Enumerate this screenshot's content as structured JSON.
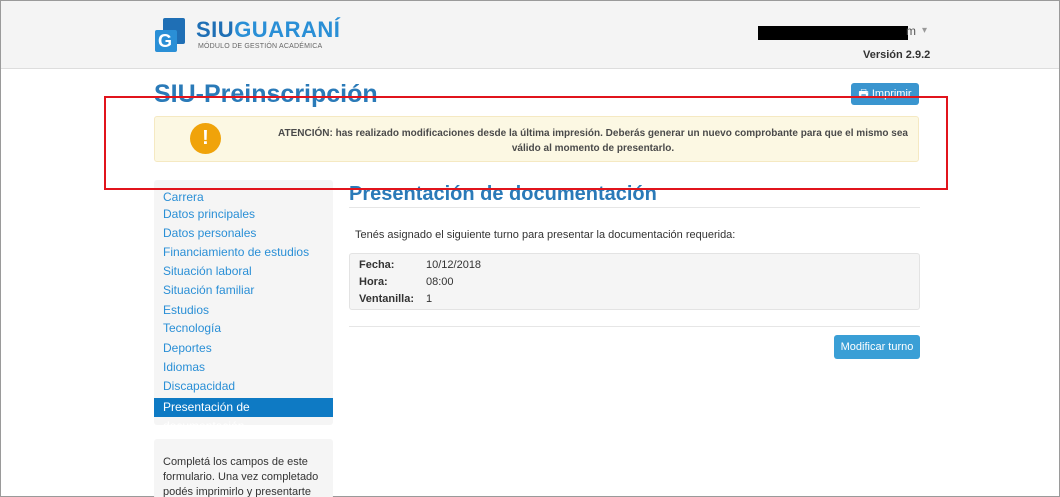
{
  "header": {
    "logo_main": "SIU",
    "logo_accent": "GUARANÍ",
    "logo_sub": "MÓDULO DE GESTIÓN ACADÉMICA",
    "logo_letter": "G",
    "user_visible_suffix": "m",
    "version": "Versión 2.9.2"
  },
  "page": {
    "title": "SIU-Preinscripción",
    "print_label": "Imprimir"
  },
  "warning": {
    "text": "ATENCIÓN: has realizado modificaciones desde la última impresión. Deberás generar un nuevo comprobante para que el mismo sea válido al momento de presentarlo."
  },
  "sidebar": {
    "items": [
      {
        "label": "Carrera"
      },
      {
        "label": "Datos principales"
      },
      {
        "label": "Datos personales"
      },
      {
        "label": "Financiamiento de estudios"
      },
      {
        "label": "Situación laboral"
      },
      {
        "label": "Situación familiar"
      },
      {
        "label": "Estudios"
      },
      {
        "label": "Tecnología"
      },
      {
        "label": "Deportes"
      },
      {
        "label": "Idiomas"
      },
      {
        "label": "Discapacidad"
      },
      {
        "label": "Presentación de documentación"
      }
    ],
    "help_text": "Completá los campos de este formulario. Una vez completado podés imprimirlo y presentarte en"
  },
  "content": {
    "title": "Presentación de documentación",
    "intro": "Tenés asignado el siguiente turno para presentar la documentación requerida:",
    "turno": {
      "fecha_label": "Fecha:",
      "fecha": "10/12/2018",
      "hora_label": "Hora:",
      "hora": "08:00",
      "ventanilla_label": "Ventanilla:",
      "ventanilla": "1"
    },
    "modify_label": "Modificar turno"
  },
  "colors": {
    "accent": "#2a8fd6",
    "warning_bg": "#fcf8e3",
    "annotation_red": "#e1141c"
  }
}
